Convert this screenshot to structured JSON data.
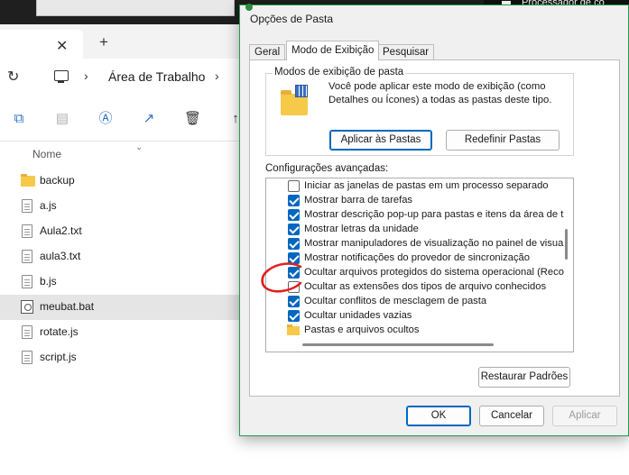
{
  "background_window": {
    "top_right_label": "Processador de co",
    "tab_close_glyph": "✕",
    "tab_new_glyph": "+",
    "breadcrumb": {
      "current": "Área de Trabalho",
      "separator": "›"
    },
    "column_header": "Nome",
    "files": [
      {
        "name": "backup",
        "type": "folder",
        "selected": false
      },
      {
        "name": "a.js",
        "type": "file",
        "selected": false
      },
      {
        "name": "Aula2.txt",
        "type": "file",
        "selected": false
      },
      {
        "name": "aula3.txt",
        "type": "file",
        "selected": false
      },
      {
        "name": "b.js",
        "type": "file",
        "selected": false
      },
      {
        "name": "meubat.bat",
        "type": "bat",
        "selected": true
      },
      {
        "name": "rotate.js",
        "type": "file",
        "selected": false
      },
      {
        "name": "script.js",
        "type": "file",
        "selected": false
      }
    ],
    "toolbar_icons": [
      "copy-icon",
      "paste-icon",
      "rename-icon",
      "share-icon",
      "delete-icon",
      "sort-icon"
    ]
  },
  "dialog": {
    "title": "Opções de Pasta",
    "tabs": [
      {
        "label": "Geral",
        "active": false
      },
      {
        "label": "Modo de Exibição",
        "active": true
      },
      {
        "label": "Pesquisar",
        "active": false
      }
    ],
    "folder_views": {
      "group_label": "Modos de exibição de pasta",
      "description": "Você pode aplicar este modo de exibição (como Detalhes ou Ícones) a todas as pastas deste tipo.",
      "apply_button": "Aplicar às Pastas",
      "reset_button": "Redefinir Pastas"
    },
    "advanced": {
      "label": "Configurações avançadas:",
      "items": [
        {
          "text": "Iniciar as janelas de pastas em um processo separado",
          "checked": false,
          "kind": "checkbox"
        },
        {
          "text": "Mostrar barra de tarefas",
          "checked": true,
          "kind": "checkbox"
        },
        {
          "text": "Mostrar descrição pop-up para pastas e itens da área de t",
          "checked": true,
          "kind": "checkbox"
        },
        {
          "text": "Mostrar letras da unidade",
          "checked": true,
          "kind": "checkbox"
        },
        {
          "text": "Mostrar manipuladores de visualização no painel de visua",
          "checked": true,
          "kind": "checkbox"
        },
        {
          "text": "Mostrar notificações do provedor de sincronização",
          "checked": true,
          "kind": "checkbox"
        },
        {
          "text": "Ocultar arquivos protegidos do sistema operacional (Reco",
          "checked": true,
          "kind": "checkbox"
        },
        {
          "text": "Ocultar as extensões dos tipos de arquivo conhecidos",
          "checked": false,
          "kind": "checkbox"
        },
        {
          "text": "Ocultar conflitos de mesclagem de pasta",
          "checked": true,
          "kind": "checkbox"
        },
        {
          "text": "Ocultar unidades vazias",
          "checked": true,
          "kind": "checkbox"
        },
        {
          "text": "Pastas e arquivos ocultos",
          "checked": false,
          "kind": "folder"
        }
      ],
      "restore_button": "Restaurar Padrões"
    },
    "footer": {
      "ok": "OK",
      "cancel": "Cancelar",
      "apply": "Aplicar"
    }
  },
  "colors": {
    "accent": "#0067c0",
    "dialog_border": "#1e9e4a",
    "annotation": "#e02020"
  }
}
